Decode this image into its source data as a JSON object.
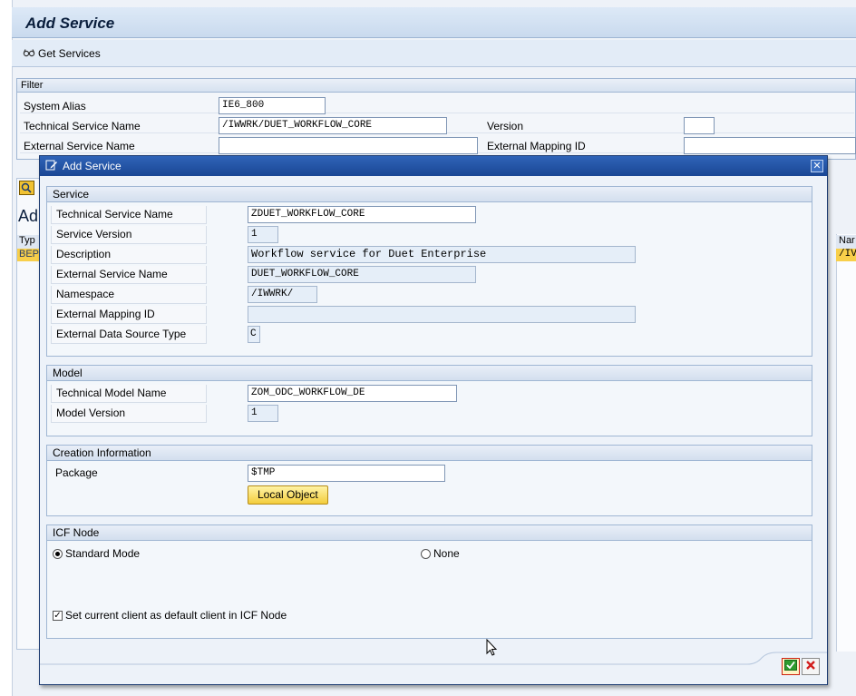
{
  "app": {
    "title": "Add Service",
    "toolbar": {
      "get_services_label": "Get Services"
    }
  },
  "filter": {
    "header": "Filter",
    "system_alias_label": "System Alias",
    "system_alias_value": "IE6_800",
    "tech_service_label": "Technical Service Name",
    "tech_service_value": "/IWWRK/DUET_WORKFLOW_CORE",
    "version_label": "Version",
    "version_value": "",
    "ext_service_label": "External Service Name",
    "ext_service_value": "",
    "ext_mapping_label": "External Mapping ID",
    "ext_mapping_value": ""
  },
  "background": {
    "heading_fragment": "Ad",
    "col_type_fragment": "Typ",
    "row_type_fragment": "BEP",
    "col_name_fragment": "Nar",
    "row_name_fragment": "/IV"
  },
  "dialog": {
    "title": "Add Service",
    "service": {
      "header": "Service",
      "rows": [
        {
          "label": "Technical Service Name",
          "value": "ZDUET_WORKFLOW_CORE"
        },
        {
          "label": "Service Version",
          "value": "1"
        },
        {
          "label": "Description",
          "value": "Workflow service for Duet Enterprise"
        },
        {
          "label": "External Service Name",
          "value": "DUET_WORKFLOW_CORE"
        },
        {
          "label": "Namespace",
          "value": "/IWWRK/"
        },
        {
          "label": "External Mapping ID",
          "value": ""
        },
        {
          "label": "External Data Source Type",
          "value": "C"
        }
      ]
    },
    "model": {
      "header": "Model",
      "rows": [
        {
          "label": "Technical Model Name",
          "value": "ZOM_ODC_WORKFLOW_DE"
        },
        {
          "label": "Model Version",
          "value": "1"
        }
      ]
    },
    "creation": {
      "header": "Creation Information",
      "package_label": "Package",
      "package_value": "$TMP",
      "local_object_button": "Local Object"
    },
    "icf": {
      "header": "ICF Node",
      "standard_mode": "Standard Mode",
      "none": "None",
      "selected": "Standard Mode",
      "default_client_label": "Set current client as default client in ICF Node",
      "default_client_checked": true
    }
  },
  "colors": {
    "title_bar": "#1a4694",
    "button_yellow": "#f3cd3c",
    "accept_green": "#2e9b2e",
    "cancel_red": "#d21e1e"
  }
}
